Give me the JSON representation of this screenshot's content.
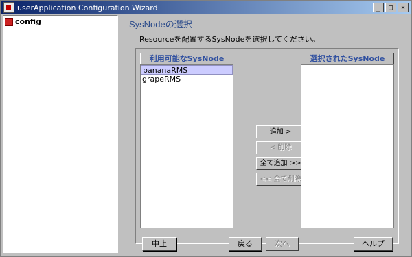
{
  "window": {
    "title": "userApplication Configuration Wizard",
    "minimize": "_",
    "maximize": "□",
    "close": "×"
  },
  "tree": {
    "root_label": "config"
  },
  "page": {
    "title": "SysNodeの選択",
    "instruction": "Resourceを配置するSysNodeを選択してください。"
  },
  "available": {
    "header": "利用可能なSysNode",
    "items": [
      "bananaRMS",
      "grapeRMS"
    ],
    "selected_index": 0
  },
  "selected": {
    "header": "選択されたSysNode",
    "items": []
  },
  "actions": {
    "add": "追加 >",
    "remove": "< 削除",
    "add_all": "全て追加 >>",
    "remove_all": "<< 全て削除"
  },
  "footer": {
    "cancel": "中止",
    "back": "戻る",
    "next": "次へ",
    "help": "ヘルプ"
  }
}
